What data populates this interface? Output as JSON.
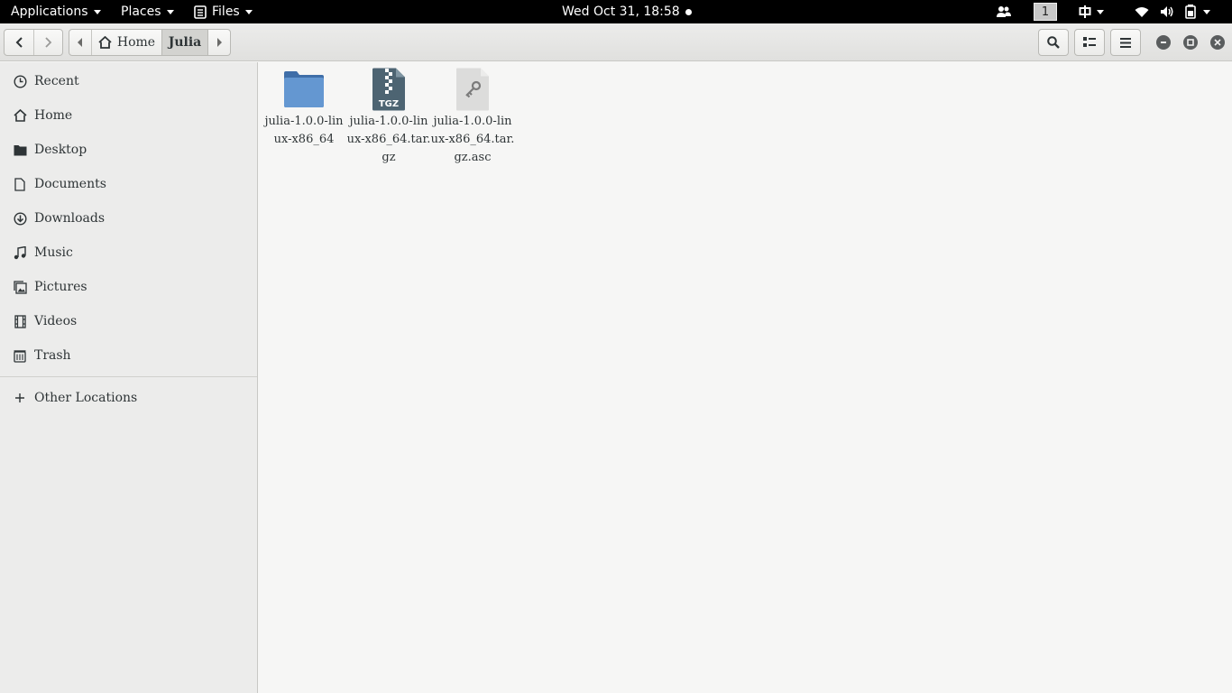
{
  "topbar": {
    "applications": "Applications",
    "places": "Places",
    "files": "Files",
    "clock": "Wed Oct 31, 18:58",
    "workspace": "1",
    "icons": [
      "people-icon",
      "keyboard-input-icon",
      "wifi-icon",
      "volume-icon",
      "battery-icon"
    ]
  },
  "header": {
    "path": {
      "home": "Home",
      "current": "Julia"
    },
    "icons": [
      "back-icon",
      "forward-icon",
      "search-icon",
      "view-toggle-icon",
      "menu-icon",
      "minimize-icon",
      "maximize-icon",
      "close-icon"
    ]
  },
  "sidebar": {
    "items": [
      {
        "label": "Recent",
        "icon": "clock-icon"
      },
      {
        "label": "Home",
        "icon": "home-icon"
      },
      {
        "label": "Desktop",
        "icon": "folder-icon"
      },
      {
        "label": "Documents",
        "icon": "document-icon"
      },
      {
        "label": "Downloads",
        "icon": "download-icon"
      },
      {
        "label": "Music",
        "icon": "music-icon"
      },
      {
        "label": "Pictures",
        "icon": "pictures-icon"
      },
      {
        "label": "Videos",
        "icon": "film-icon"
      },
      {
        "label": "Trash",
        "icon": "trash-icon"
      }
    ],
    "other": {
      "label": "Other Locations",
      "icon": "plus-icon"
    }
  },
  "files": [
    {
      "name": "julia-1.0.0-linux-x86_64",
      "type": "folder"
    },
    {
      "name": "julia-1.0.0-linux-x86_64.tar.gz",
      "type": "archive",
      "badge": "TGZ"
    },
    {
      "name": "julia-1.0.0-linux-x86_64.tar.gz.asc",
      "type": "key"
    }
  ],
  "colors": {
    "folder": "#5e8ec7",
    "archive": "#4d6472",
    "key": "#d8d8d8",
    "topbar": "#000000"
  }
}
